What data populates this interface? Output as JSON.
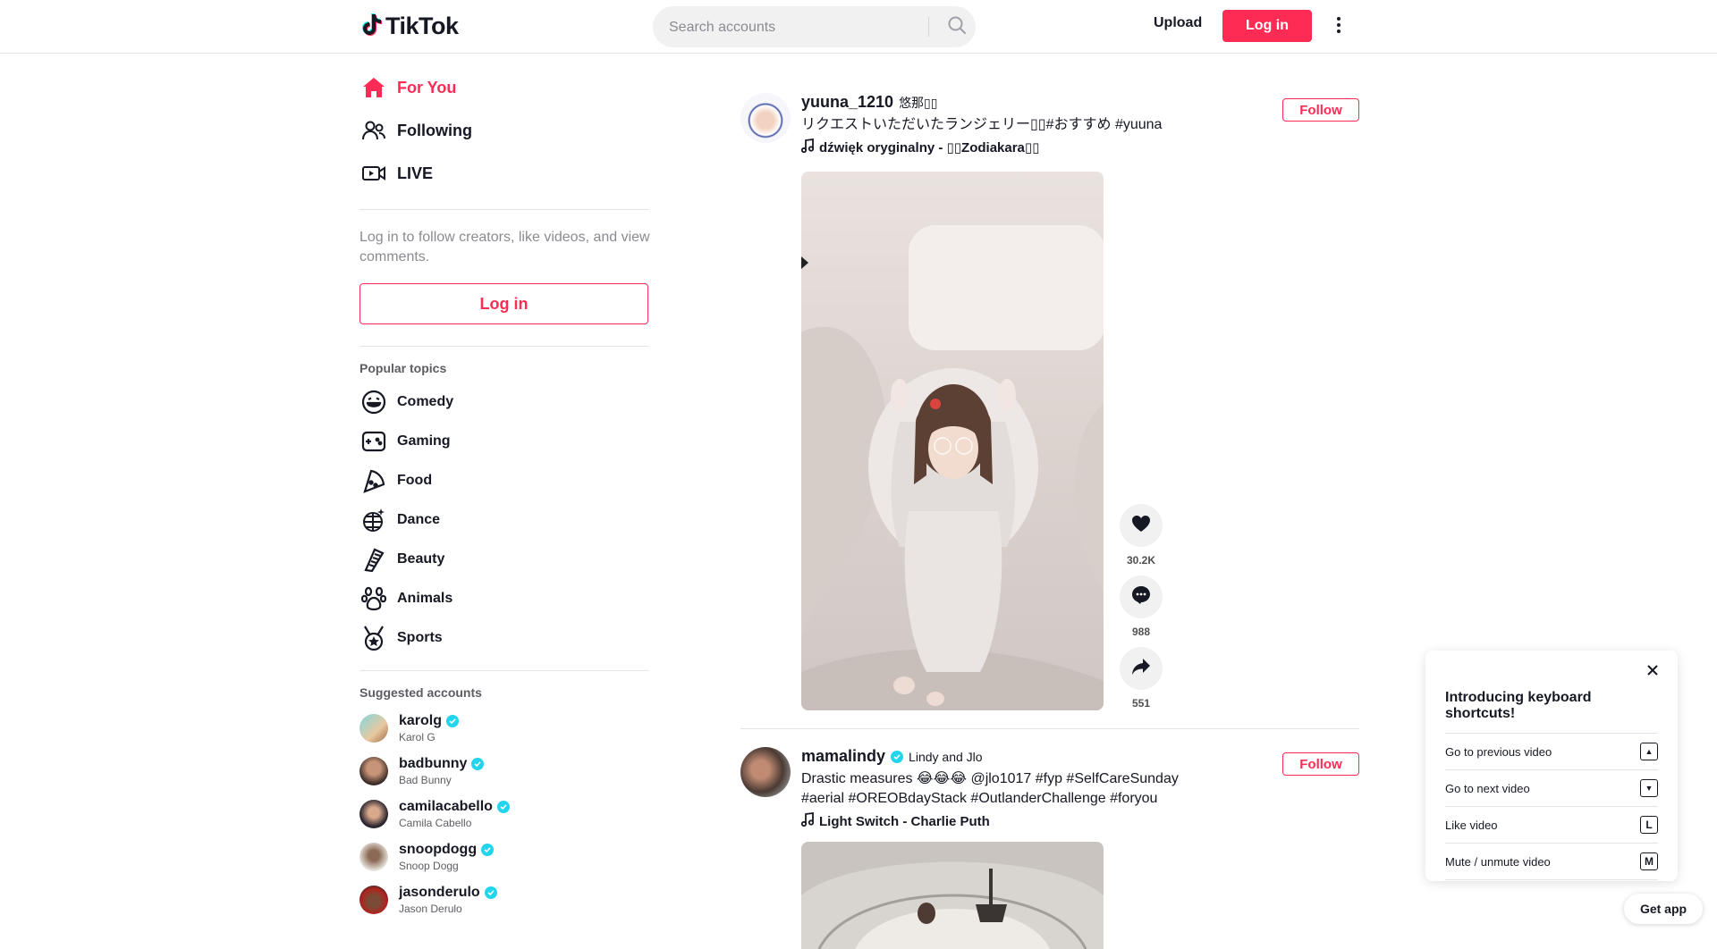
{
  "header": {
    "logo_text": "TikTok",
    "search_placeholder": "Search accounts",
    "upload_label": "Upload",
    "login_label": "Log in"
  },
  "sidebar": {
    "nav": [
      {
        "label": "For You",
        "icon": "home-icon"
      },
      {
        "label": "Following",
        "icon": "following-icon"
      },
      {
        "label": "LIVE",
        "icon": "live-icon"
      }
    ],
    "login_hint": "Log in to follow creators, like videos, and view comments.",
    "login_button": "Log in",
    "topics_title": "Popular topics",
    "topics": [
      {
        "label": "Comedy",
        "icon": "comedy-icon"
      },
      {
        "label": "Gaming",
        "icon": "gaming-icon"
      },
      {
        "label": "Food",
        "icon": "food-icon"
      },
      {
        "label": "Dance",
        "icon": "dance-icon"
      },
      {
        "label": "Beauty",
        "icon": "beauty-icon"
      },
      {
        "label": "Animals",
        "icon": "animals-icon"
      },
      {
        "label": "Sports",
        "icon": "sports-icon"
      }
    ],
    "suggested_title": "Suggested accounts",
    "accounts": [
      {
        "username": "karolg",
        "display": "Karol G"
      },
      {
        "username": "badbunny",
        "display": "Bad Bunny"
      },
      {
        "username": "camilacabello",
        "display": "Camila Cabello"
      },
      {
        "username": "snoopdogg",
        "display": "Snoop Dogg"
      },
      {
        "username": "jasonderulo",
        "display": "Jason Derulo"
      }
    ]
  },
  "posts": [
    {
      "username": "yuuna_1210",
      "nickname": "悠那▯▯",
      "description": "リクエストいただいたランジェリー▯▯#おすすめ #yuuna",
      "music": "dźwięk oryginalny - ▯▯Zodiakara▯▯",
      "follow_label": "Follow",
      "likes": "30.2K",
      "comments": "988",
      "shares": "551"
    },
    {
      "username": "mamalindy",
      "nickname": "Lindy and Jlo",
      "description": "Drastic measures 😂😂😂 @jlo1017 #fyp #SelfCareSunday #aerial #OREOBdayStack #OutlanderChallenge #foryou",
      "music": "Light Switch - Charlie Puth",
      "follow_label": "Follow"
    }
  ],
  "keyboard": {
    "title": "Introducing keyboard shortcuts!",
    "rows": [
      {
        "label": "Go to previous video",
        "key": "▲"
      },
      {
        "label": "Go to next video",
        "key": "▼"
      },
      {
        "label": "Like video",
        "key": "L"
      },
      {
        "label": "Mute / unmute video",
        "key": "M"
      }
    ]
  },
  "get_app_label": "Get app",
  "colors": {
    "accent": "#fe2c55",
    "verified": "#20d5ec"
  }
}
